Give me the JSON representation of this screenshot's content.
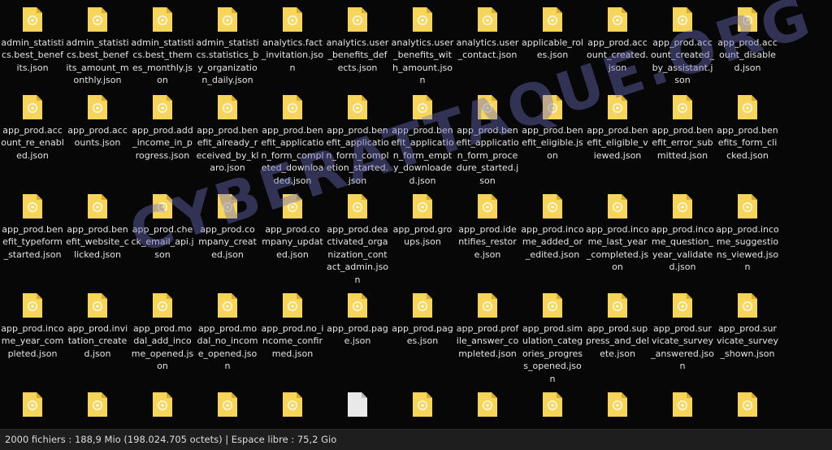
{
  "watermark": "CYBERATTAQUE.ORG",
  "colors": {
    "folder_yellow": "#f7d55a",
    "folder_dark": "#d7ad28",
    "blank_file": "#e9e9e9",
    "background": "#070707"
  },
  "files": [
    {
      "name": "admin_statistics.best_benefits.json",
      "icon": "json-file-icon"
    },
    {
      "name": "admin_statistics.best_benefits_amount_monthly.json",
      "icon": "json-file-icon"
    },
    {
      "name": "admin_statistics.best_themes_monthly.json",
      "icon": "json-file-icon"
    },
    {
      "name": "admin_statistics.statistics_by_organization_daily.json",
      "icon": "json-file-icon"
    },
    {
      "name": "analytics.fact_invitation.json",
      "icon": "json-file-icon"
    },
    {
      "name": "analytics.user_benefits_defects.json",
      "icon": "json-file-icon"
    },
    {
      "name": "analytics.user_benefits_with_amount.json",
      "icon": "json-file-icon"
    },
    {
      "name": "analytics.user_contact.json",
      "icon": "json-file-icon"
    },
    {
      "name": "applicable_roles.json",
      "icon": "json-file-icon"
    },
    {
      "name": "app_prod.account_created.json",
      "icon": "json-file-icon"
    },
    {
      "name": "app_prod.account_created_by_assistant.json",
      "icon": "json-file-icon"
    },
    {
      "name": "app_prod.account_disabled.json",
      "icon": "json-file-icon"
    },
    {
      "name": "app_prod.account_re_enabled.json",
      "icon": "json-file-icon"
    },
    {
      "name": "app_prod.accounts.json",
      "icon": "json-file-icon"
    },
    {
      "name": "app_prod.add_income_in_progress.json",
      "icon": "json-file-icon"
    },
    {
      "name": "app_prod.benefit_already_received_by_klaro.json",
      "icon": "json-file-icon"
    },
    {
      "name": "app_prod.benefit_application_form_completed_downloaded.json",
      "icon": "json-file-icon"
    },
    {
      "name": "app_prod.benefit_application_form_completion_started.json",
      "icon": "json-file-icon"
    },
    {
      "name": "app_prod.benefit_application_form_empty_downloaded.json",
      "icon": "json-file-icon"
    },
    {
      "name": "app_prod.benefit_application_form_procedure_started.json",
      "icon": "json-file-icon"
    },
    {
      "name": "app_prod.benefit_eligible.json",
      "icon": "json-file-icon"
    },
    {
      "name": "app_prod.benefit_eligible_viewed.json",
      "icon": "json-file-icon"
    },
    {
      "name": "app_prod.benefit_error_submitted.json",
      "icon": "json-file-icon"
    },
    {
      "name": "app_prod.benefits_form_clicked.json",
      "icon": "json-file-icon"
    },
    {
      "name": "app_prod.benefit_typeform_started.json",
      "icon": "json-file-icon"
    },
    {
      "name": "app_prod.benefit_website_clicked.json",
      "icon": "json-file-icon"
    },
    {
      "name": "app_prod.check_email_api.json",
      "icon": "json-file-icon"
    },
    {
      "name": "app_prod.company_created.json",
      "icon": "json-file-icon"
    },
    {
      "name": "app_prod.company_updated.json",
      "icon": "json-file-icon"
    },
    {
      "name": "app_prod.deactivated_organization_contact_admin.json",
      "icon": "json-file-icon"
    },
    {
      "name": "app_prod.groups.json",
      "icon": "json-file-icon"
    },
    {
      "name": "app_prod.identifies_restore.json",
      "icon": "json-file-icon"
    },
    {
      "name": "app_prod.income_added_or_edited.json",
      "icon": "json-file-icon"
    },
    {
      "name": "app_prod.income_last_year_completed.json",
      "icon": "json-file-icon"
    },
    {
      "name": "app_prod.income_question_year_validated.json",
      "icon": "json-file-icon"
    },
    {
      "name": "app_prod.income_suggestions_viewed.json",
      "icon": "json-file-icon"
    },
    {
      "name": "app_prod.income_year_completed.json",
      "icon": "json-file-icon"
    },
    {
      "name": "app_prod.invitation_created.json",
      "icon": "json-file-icon"
    },
    {
      "name": "app_prod.modal_add_income_opened.json",
      "icon": "json-file-icon"
    },
    {
      "name": "app_prod.modal_no_income_opened.json",
      "icon": "json-file-icon"
    },
    {
      "name": "app_prod.no_income_confirmed.json",
      "icon": "json-file-icon"
    },
    {
      "name": "app_prod.page.json",
      "icon": "json-file-icon"
    },
    {
      "name": "app_prod.pages.json",
      "icon": "json-file-icon"
    },
    {
      "name": "app_prod.profile_answer_completed.json",
      "icon": "json-file-icon"
    },
    {
      "name": "app_prod.simulation_categories_progress_opened.json",
      "icon": "json-file-icon"
    },
    {
      "name": "app_prod.suppress_and_delete.json",
      "icon": "json-file-icon"
    },
    {
      "name": "app_prod.survicate_survey_answered.json",
      "icon": "json-file-icon"
    },
    {
      "name": "app_prod.survicate_survey_shown.json",
      "icon": "json-file-icon"
    },
    {
      "name": "",
      "icon": "json-file-icon"
    },
    {
      "name": "",
      "icon": "json-file-icon"
    },
    {
      "name": "",
      "icon": "json-file-icon"
    },
    {
      "name": "",
      "icon": "json-file-icon"
    },
    {
      "name": "",
      "icon": "json-file-icon"
    },
    {
      "name": "",
      "icon": "blank-file-icon"
    },
    {
      "name": "",
      "icon": "json-file-icon"
    },
    {
      "name": "",
      "icon": "json-file-icon"
    },
    {
      "name": "",
      "icon": "json-file-icon"
    },
    {
      "name": "",
      "icon": "json-file-icon"
    },
    {
      "name": "",
      "icon": "json-file-icon"
    },
    {
      "name": "",
      "icon": "json-file-icon"
    }
  ],
  "statusbar": {
    "text": "2000 fichiers : 188,9 Mio (198.024.705 octets)  |  Espace libre : 75,2 Gio"
  }
}
